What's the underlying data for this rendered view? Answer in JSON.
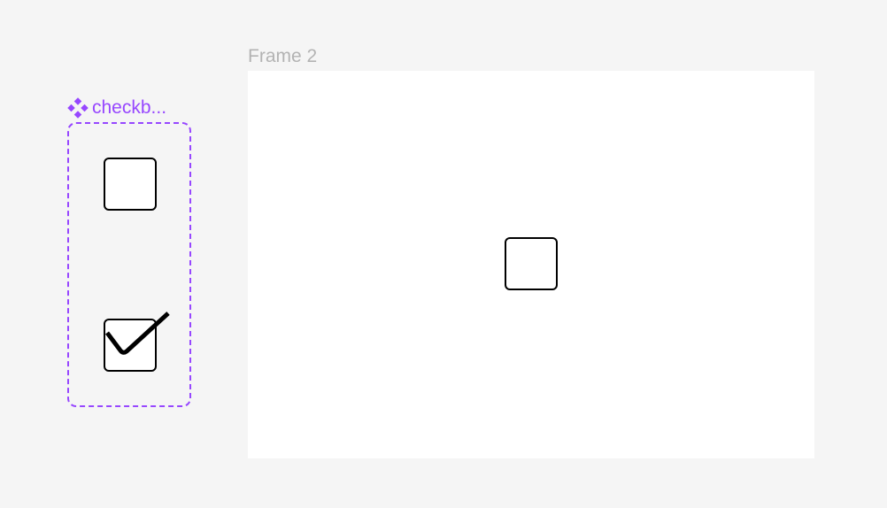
{
  "canvas": {
    "background": "#f5f5f5"
  },
  "component_set": {
    "name": "checkb...",
    "icon": "component-set-icon",
    "accent_color": "#9747ff",
    "variants": [
      {
        "name": "checkbox-unchecked",
        "checked": false
      },
      {
        "name": "checkbox-checked",
        "checked": true
      }
    ]
  },
  "frame": {
    "title": "Frame 2",
    "background": "#ffffff",
    "title_color": "#b3b3b3",
    "instance": {
      "name": "checkbox-instance",
      "checked": false
    }
  }
}
